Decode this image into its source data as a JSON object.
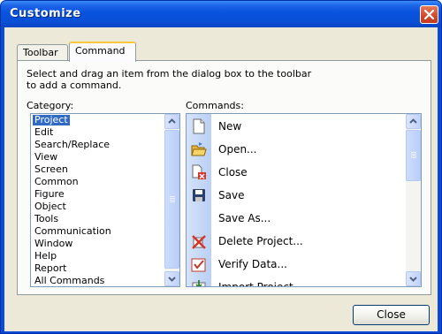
{
  "window": {
    "title": "Customize"
  },
  "tabs": [
    {
      "label": "Toolbar",
      "active": false
    },
    {
      "label": "Command",
      "active": true
    }
  ],
  "instruction": "Select and drag an item from the dialog box to the toolbar\nto add a command.",
  "category": {
    "label": "Category:",
    "selected": "Project",
    "items": [
      "Project",
      "Edit",
      "Search/Replace",
      "View",
      "Screen",
      "Common",
      "Figure",
      "Object",
      "Tools",
      "Communication",
      "Window",
      "Help",
      "Report",
      "All Commands"
    ]
  },
  "commands": {
    "label": "Commands:",
    "items": [
      {
        "label": "New",
        "icon": "new-document-icon"
      },
      {
        "label": "Open...",
        "icon": "open-folder-icon"
      },
      {
        "label": "Close",
        "icon": "close-document-icon"
      },
      {
        "label": "Save",
        "icon": "save-disk-icon"
      },
      {
        "label": "Save As...",
        "icon": ""
      },
      {
        "label": "Delete Project...",
        "icon": "delete-project-icon"
      },
      {
        "label": "Verify Data...",
        "icon": "verify-data-icon"
      },
      {
        "label": "Import Project...",
        "icon": "import-project-icon"
      }
    ]
  },
  "buttons": {
    "close": "Close"
  },
  "colors": {
    "titlebar": "#0a4fd5",
    "selection": "#316ac5",
    "dialog_bg": "#ece9d8",
    "active_tab_accent": "#ffc83c"
  }
}
